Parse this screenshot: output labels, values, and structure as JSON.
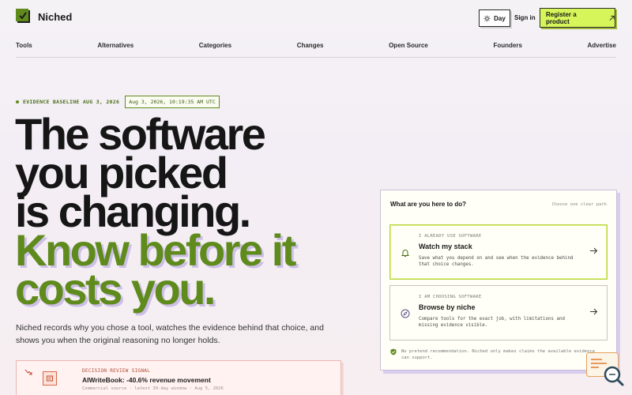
{
  "header": {
    "brand": "Niched",
    "day_label": "Day",
    "signin_label": "Sign in",
    "register_label": "Register a product"
  },
  "nav": {
    "items": [
      "Tools",
      "Alternatives",
      "Categories",
      "Changes",
      "Open Source",
      "Founders",
      "Advertise"
    ]
  },
  "evidence": {
    "label": "EVIDENCE BASELINE AUG 3, 2026",
    "stamp": "Aug 3, 2026, 10:19:35 AM UTC"
  },
  "hero": {
    "line1": "The software",
    "line2": "you picked",
    "line3": "is changing.",
    "line4": "Know before it",
    "line5": "costs you.",
    "lede": "Niched records why you chose a tool, watches the evidence behind that choice, and shows you when the original reasoning no longer holds."
  },
  "signal": {
    "tag": "DECISION REVIEW SIGNAL",
    "title": "AIWriteBook: -40.6% revenue movement",
    "sub": "Commercial source · latest 30-day window · Aug 5, 2026"
  },
  "panel": {
    "title": "What are you here to do?",
    "hint": "Choose one clear path",
    "options": [
      {
        "tag": "I ALREADY USE SOFTWARE",
        "title": "Watch my stack",
        "desc": "Save what you depend on and see when the evidence behind that choice changes.",
        "icon": "bell-icon"
      },
      {
        "tag": "I AM CHOOSING SOFTWARE",
        "title": "Browse by niche",
        "desc": "Compare tools for the exact job, with limitations and missing evidence visible.",
        "icon": "compass-icon"
      }
    ],
    "note": "No pretend recommendation. Niched only makes claims the available evidence can support."
  },
  "colors": {
    "accent_green": "#5f8a1c",
    "register_bg": "#d6f55a",
    "shadow_purple": "#cdbfe8",
    "signal_red": "#c04a3a"
  }
}
